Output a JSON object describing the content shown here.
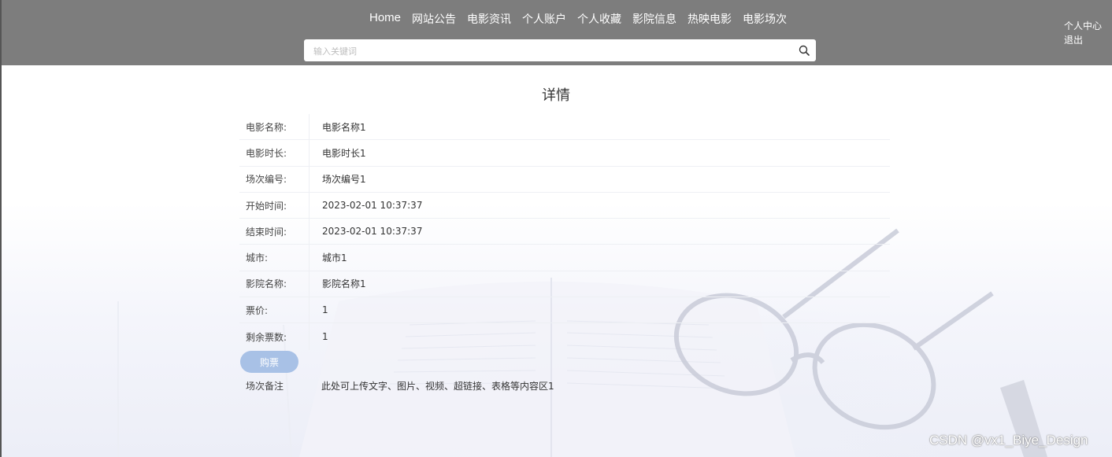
{
  "nav": {
    "items": [
      "Home",
      "网站公告",
      "电影资讯",
      "个人账户",
      "个人收藏",
      "影院信息",
      "热映电影",
      "电影场次"
    ]
  },
  "search": {
    "placeholder": "输入关键词",
    "icon": "search-icon"
  },
  "user_menu": {
    "center": "个人中心",
    "logout": "退出"
  },
  "page": {
    "title": "详情"
  },
  "details": [
    {
      "label": "电影名称:",
      "value": "电影名称1"
    },
    {
      "label": "电影时长:",
      "value": "电影时长1"
    },
    {
      "label": "场次编号:",
      "value": "场次编号1"
    },
    {
      "label": "开始时间:",
      "value": "2023-02-01 10:37:37"
    },
    {
      "label": "结束时间:",
      "value": "2023-02-01 10:37:37"
    },
    {
      "label": "城市:",
      "value": "城市1"
    },
    {
      "label": "影院名称:",
      "value": "影院名称1"
    },
    {
      "label": "票价:",
      "value": "1"
    },
    {
      "label": "剩余票数:",
      "value": "1"
    }
  ],
  "buy_button": "购票",
  "notes": {
    "label": "场次备注",
    "value": "此处可上传文字、图片、视频、超链接、表格等内容区1"
  },
  "watermark": "CSDN @vx1_Biye_Design",
  "colors": {
    "header": "#7d7d7d",
    "button": "#a8c1e6"
  }
}
